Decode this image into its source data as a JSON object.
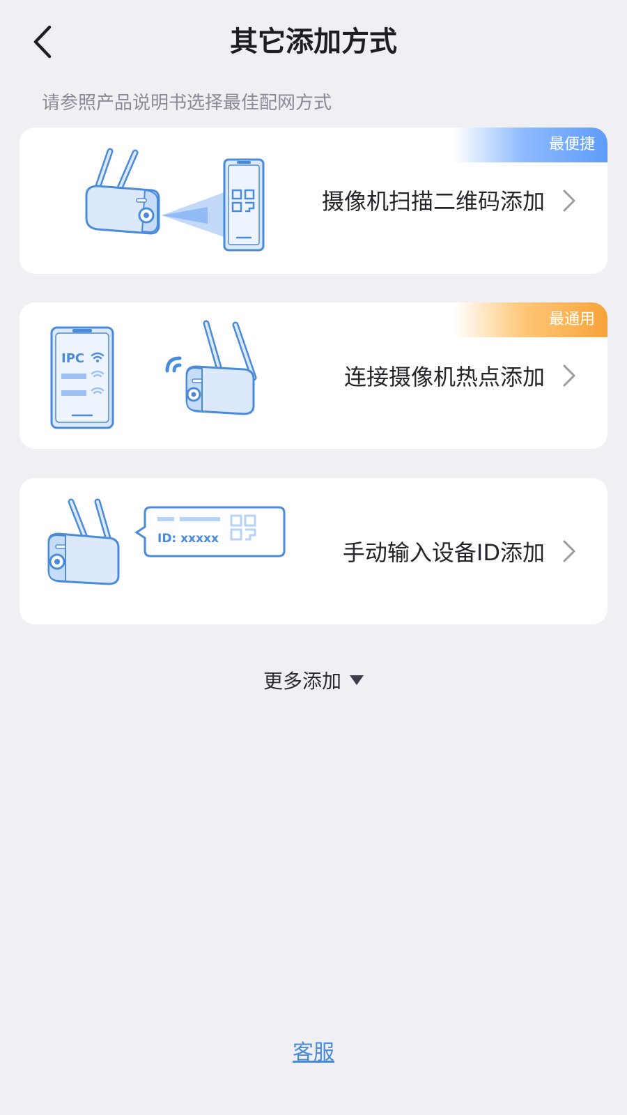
{
  "header": {
    "title": "其它添加方式",
    "back_icon": "chevron-left-icon"
  },
  "subtitle": "请参照产品说明书选择最佳配网方式",
  "methods": [
    {
      "label": "摄像机扫描二维码添加",
      "badge": "最便捷",
      "badge_color": "#5e9cfa",
      "icon": "camera-scan-qr-illustration"
    },
    {
      "label": "连接摄像机热点添加",
      "badge": "最通用",
      "badge_color": "#f7a33a",
      "icon": "camera-hotspot-illustration",
      "illustration_text": "IPC"
    },
    {
      "label": "手动输入设备ID添加",
      "icon": "camera-device-id-illustration",
      "illustration_text": "ID: xxxxx"
    }
  ],
  "more": {
    "label": "更多添加",
    "icon": "triangle-down-icon"
  },
  "support_link": "客服",
  "colors": {
    "background": "#efeff4",
    "illustration_stroke": "#4a8bd9",
    "illustration_fill": "#dce9fb",
    "link": "#4a8bd9"
  }
}
